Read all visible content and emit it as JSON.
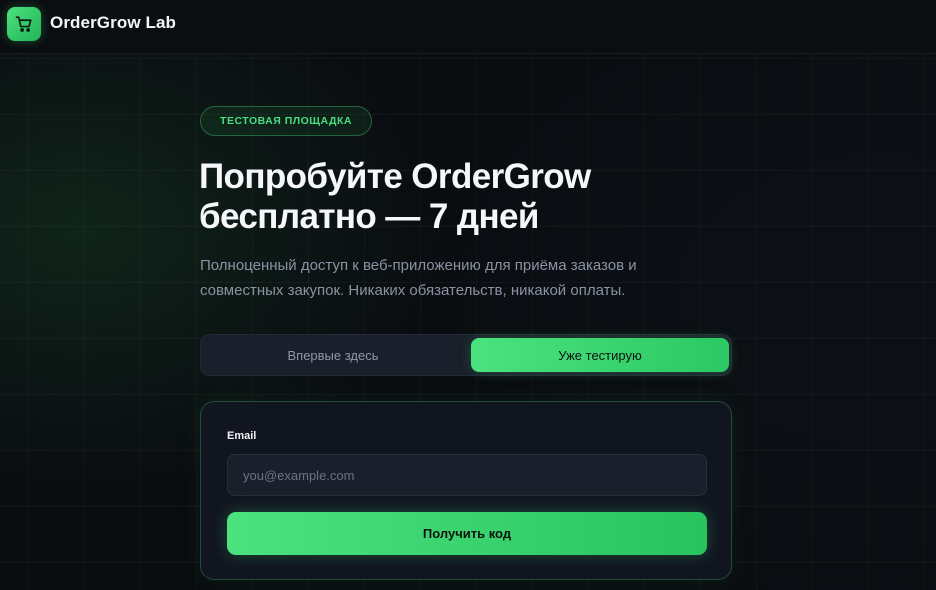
{
  "header": {
    "brand": "OrderGrow Lab",
    "logo_icon": "shopping-cart-icon"
  },
  "hero": {
    "badge": "ТЕСТОВАЯ ПЛОЩАДКА",
    "title_line1": "Попробуйте OrderGrow",
    "title_line2": "бесплатно — 7 дней",
    "subtitle_line1": "Полноценный доступ к веб-приложению для приёма заказов и",
    "subtitle_line2": "совместных закупок. Никаких обязательств, никакой оплаты."
  },
  "mode_switch": {
    "options": [
      {
        "label": "Впервые здесь",
        "active": false
      },
      {
        "label": "Уже тестирую",
        "active": true
      }
    ]
  },
  "form": {
    "email_label": "Email",
    "email_value": "",
    "email_placeholder": "you@example.com",
    "submit_label": "Получить код"
  },
  "colors": {
    "accent": "#4ade80",
    "background": "#0a0c10",
    "card": "#111520"
  }
}
